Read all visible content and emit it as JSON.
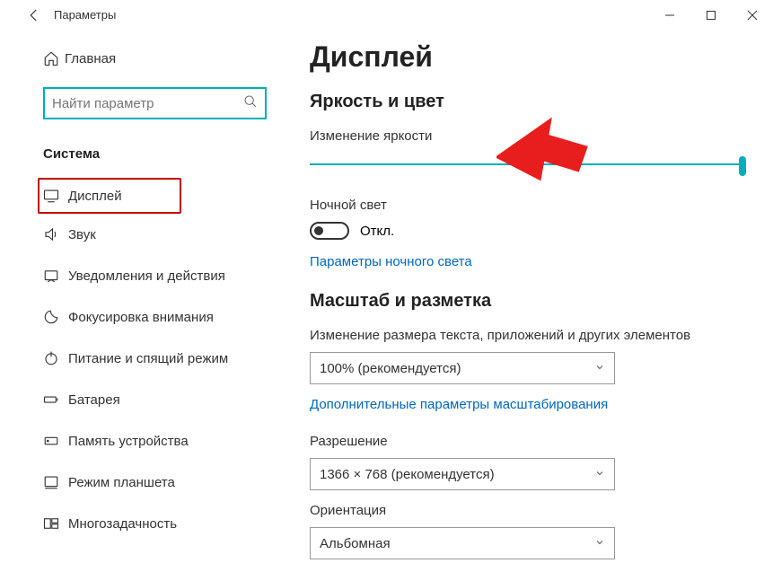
{
  "titlebar": {
    "title": "Параметры"
  },
  "sidebar": {
    "home": "Главная",
    "search_placeholder": "Найти параметр",
    "section": "Система",
    "items": [
      {
        "label": "Дисплей"
      },
      {
        "label": "Звук"
      },
      {
        "label": "Уведомления и действия"
      },
      {
        "label": "Фокусировка внимания"
      },
      {
        "label": "Питание и спящий режим"
      },
      {
        "label": "Батарея"
      },
      {
        "label": "Память устройства"
      },
      {
        "label": "Режим планшета"
      },
      {
        "label": "Многозадачность"
      }
    ]
  },
  "content": {
    "title": "Дисплей",
    "brightness_section": "Яркость и цвет",
    "brightness_label": "Изменение яркости",
    "nightlight_label": "Ночной свет",
    "toggle_state": "Откл.",
    "nightlight_link": "Параметры ночного света",
    "scale_section": "Масштаб и разметка",
    "scale_label": "Изменение размера текста, приложений и других элементов",
    "scale_value": "100% (рекомендуется)",
    "scale_link": "Дополнительные параметры масштабирования",
    "resolution_label": "Разрешение",
    "resolution_value": "1366 × 768 (рекомендуется)",
    "orientation_label": "Ориентация",
    "orientation_value": "Альбомная"
  }
}
